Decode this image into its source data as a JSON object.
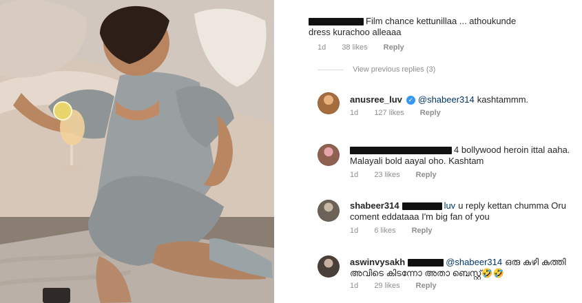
{
  "comments_panel": {
    "top_comment": {
      "text": "Film chance kettunillaa ... athoukunde dress kurachoo alleaaa",
      "time": "1d",
      "likes": "38 likes",
      "reply": "Reply"
    },
    "view_replies": "View previous replies (3)",
    "replies": [
      {
        "username": "anusree_luv",
        "verified": true,
        "mention": "@shabeer314",
        "text": "kashtammm.",
        "time": "1d",
        "likes": "127 likes",
        "reply": "Reply"
      },
      {
        "mention_suffix": "4",
        "text": "bollywood heroin ittal aaha. Malayali bold aayal oho. Kashtam",
        "time": "1d",
        "likes": "23 likes",
        "reply": "Reply"
      },
      {
        "username": "shabeer314",
        "mention_suffix": "luv",
        "text": "u reply kettan chumma Oru coment eddataaa I'm big fan of you",
        "time": "1d",
        "likes": "6 likes",
        "reply": "Reply"
      },
      {
        "username": "aswinvysakh",
        "mention": "@shabeer314",
        "text": "ഒരു കുഴി കുത്തി അവിടെ കിടന്നോ അതാ ബെസ്റ്റ്",
        "emoji": "🤣🤣",
        "time": "1d",
        "likes": "29 likes",
        "reply": "Reply"
      }
    ]
  },
  "colors": {
    "text": "#262626",
    "meta": "#8e8e8e",
    "verified": "#3897f0",
    "mention": "#003569"
  }
}
